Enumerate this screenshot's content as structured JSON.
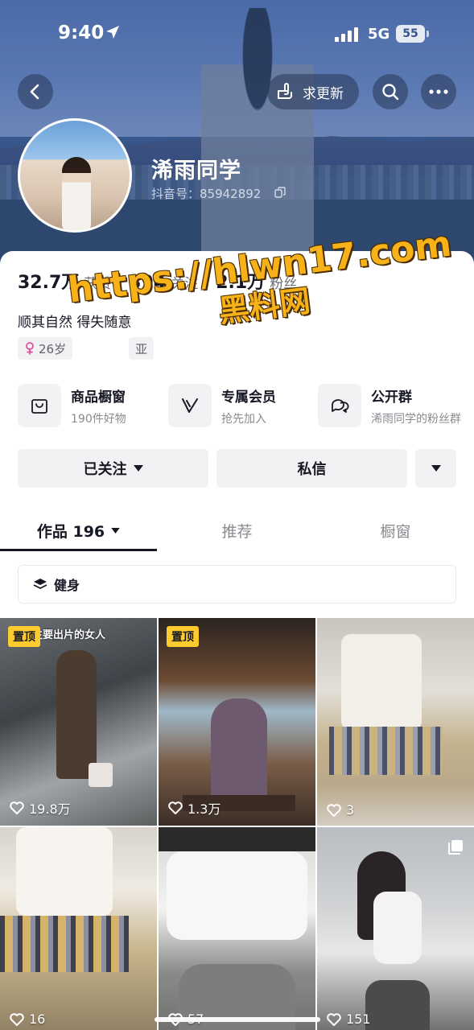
{
  "status_bar": {
    "time": "9:40",
    "network": "5G",
    "battery": "55"
  },
  "nav": {
    "request_update_label": "求更新"
  },
  "profile": {
    "nickname": "浠雨同学",
    "douyin_id": "抖音号：85942892",
    "stats": [
      {
        "value": "32.7万",
        "label": "获赞"
      },
      {
        "value": "394",
        "label": "关注"
      },
      {
        "value": "2.1万",
        "label": "粉丝"
      }
    ],
    "bio": "顺其自然 得失随意",
    "tags": [
      {
        "label": "26岁"
      },
      {
        "label": "亚"
      }
    ]
  },
  "watermark": {
    "line1": "https://hlwn17.com",
    "line2": "黑料网"
  },
  "features": [
    {
      "title": "商品橱窗",
      "subtitle": "190件好物",
      "icon": "shopping-bag-icon"
    },
    {
      "title": "专属会员",
      "subtitle": "抢先加入",
      "icon": "v-member-icon"
    },
    {
      "title": "公开群",
      "subtitle": "浠雨同学的粉丝群",
      "icon": "chat-group-icon"
    }
  ],
  "actions": {
    "followed_label": "已关注",
    "message_label": "私信"
  },
  "tabs": [
    {
      "label": "作品 196",
      "active": true
    },
    {
      "label": "推荐",
      "active": false
    },
    {
      "label": "橱窗",
      "active": false
    }
  ],
  "collection": {
    "label": "健身"
  },
  "videos": [
    {
      "pinned": true,
      "pin_label": "置顶",
      "likes": "19.8万",
      "caption": "主要出片的女人"
    },
    {
      "pinned": true,
      "pin_label": "置顶",
      "likes": "1.3万"
    },
    {
      "pinned": false,
      "likes": "3"
    },
    {
      "pinned": false,
      "likes": "16"
    },
    {
      "pinned": false,
      "likes": "57"
    },
    {
      "pinned": false,
      "likes": "151",
      "multi_image": true
    }
  ],
  "colors": {
    "accent_pin": "#fecb2f",
    "header_blue": "#3a5c95",
    "watermark_orange": "#f7b21a"
  }
}
